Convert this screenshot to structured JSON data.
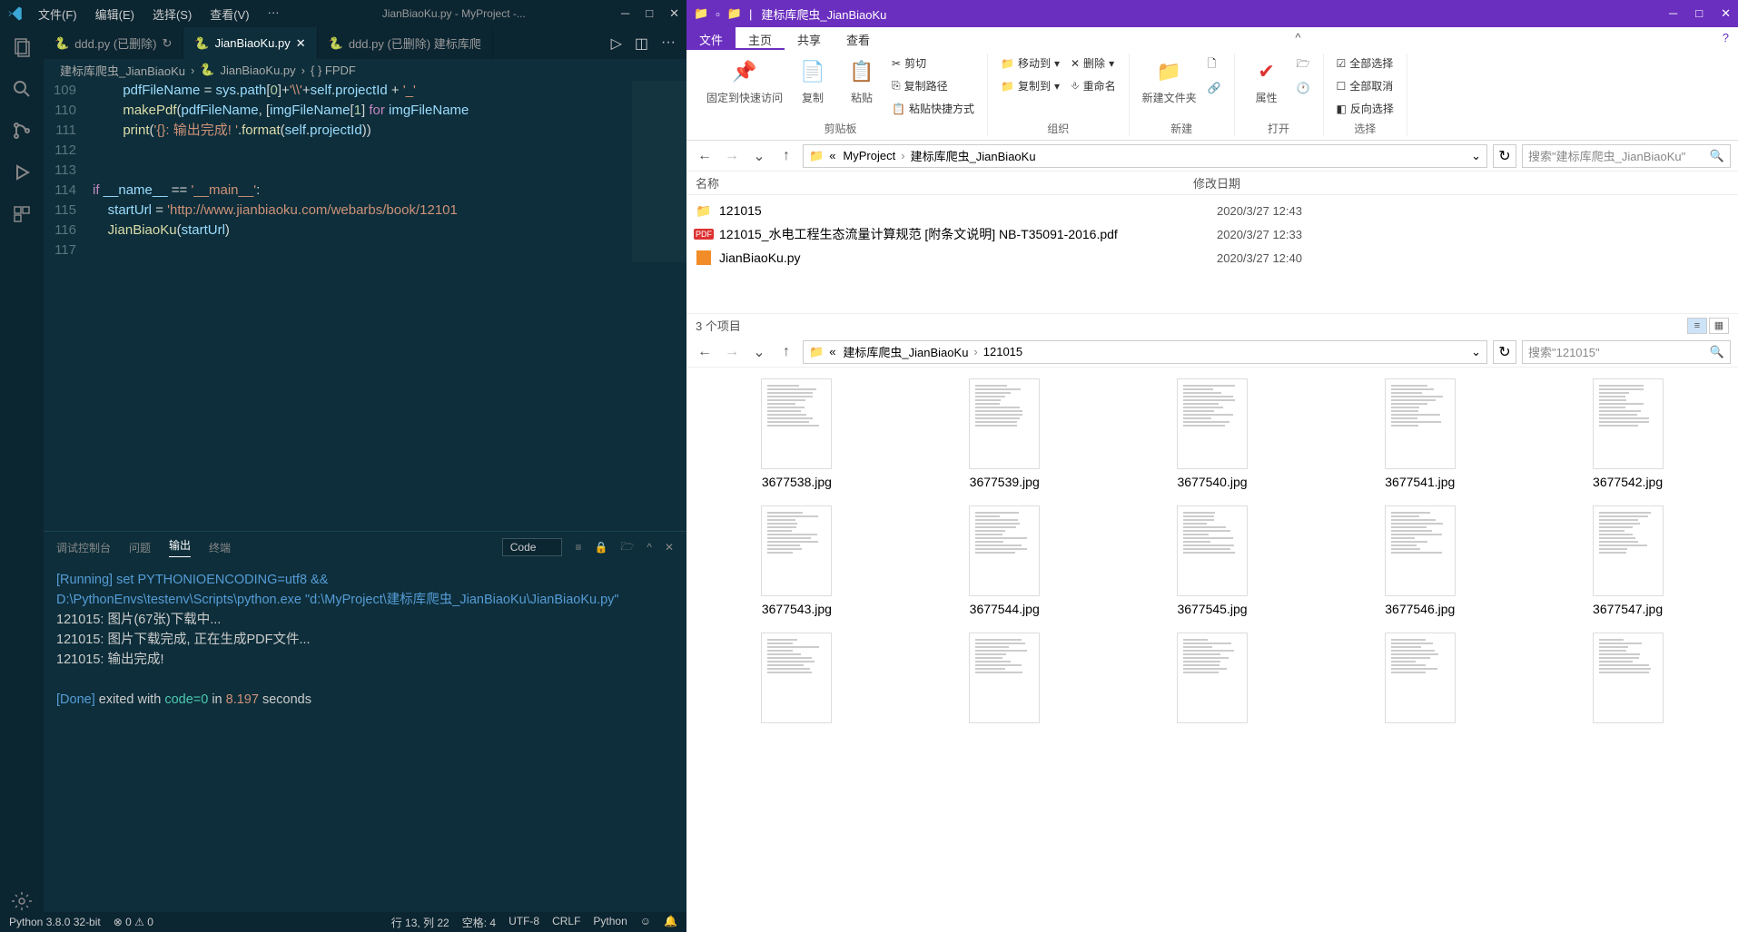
{
  "vscode": {
    "menu": [
      "文件(F)",
      "编辑(E)",
      "选择(S)",
      "查看(V)",
      "···"
    ],
    "title": "JianBiaoKu.py - MyProject -...",
    "tabs": [
      {
        "label": "ddd.py (已删除)",
        "active": false
      },
      {
        "label": "JianBiaoKu.py",
        "active": true
      },
      {
        "label": "ddd.py (已删除) 建标库爬",
        "active": false
      }
    ],
    "breadcrumb": [
      "建标库爬虫_JianBiaoKu",
      "JianBiaoKu.py",
      "{ } FPDF"
    ],
    "lines": {
      "109": "            pdfFileName = sys.path[0]+'\\\\'+self.projectId + '_'",
      "110": "            makePdf(pdfFileName, [imgFileName[1] for imgFileName",
      "111": "            print('{}: 输出完成! '.format(self.projectId))",
      "112": "",
      "113": "",
      "114": "    if __name__ == '__main__':",
      "115": "        startUrl = 'http://www.jianbiaoku.com/webarbs/book/12101",
      "116": "        JianBiaoKu(startUrl)",
      "117": ""
    },
    "panel": {
      "tabs": [
        "调试控制台",
        "问题",
        "输出",
        "终端"
      ],
      "active": "输出",
      "select": "Code",
      "output": {
        "l1a": "[Running]",
        "l1b": " set PYTHONIOENCODING=utf8 && ",
        "l2": "D:\\PythonEnvs\\testenv\\Scripts\\python.exe \"d:\\MyProject\\建标库爬虫_JianBiaoKu\\JianBiaoKu.py\"",
        "l3": "121015: 图片(67张)下载中...",
        "l4": "121015: 图片下载完成, 正在生成PDF文件...",
        "l5": "121015: 输出完成!",
        "l6a": "[Done]",
        "l6b": " exited with ",
        "l6c": "code=0",
        "l6d": " in ",
        "l6e": "8.197",
        "l6f": " seconds"
      }
    },
    "status": {
      "python": "Python 3.8.0 32-bit",
      "errors": "⊗ 0 ⚠ 0",
      "ln": "行 13, 列 22",
      "spaces": "空格: 4",
      "enc": "UTF-8",
      "eol": "CRLF",
      "lang": "Python"
    }
  },
  "explorer": {
    "title": "建标库爬虫_JianBiaoKu",
    "ribbon_tabs": {
      "file": "文件",
      "items": [
        "主页",
        "共享",
        "查看"
      ],
      "active": "主页"
    },
    "ribbon": {
      "pin": "固定到快速访问",
      "copy": "复制",
      "paste": "粘贴",
      "cut": "剪切",
      "copypath": "复制路径",
      "pasteshort": "粘贴快捷方式",
      "clipboard": "剪贴板",
      "moveto": "移动到",
      "copyto": "复制到",
      "delete": "删除",
      "rename": "重命名",
      "organize": "组织",
      "newfolder": "新建文件夹",
      "new": "新建",
      "props": "属性",
      "open": "打开",
      "selall": "全部选择",
      "selnone": "全部取消",
      "selinv": "反向选择",
      "select": "选择"
    },
    "top": {
      "path": [
        "«",
        "MyProject",
        "建标库爬虫_JianBiaoKu"
      ],
      "search": "搜索\"建标库爬虫_JianBiaoKu\"",
      "cols": {
        "name": "名称",
        "date": "修改日期"
      },
      "files": [
        {
          "icon": "folder",
          "name": "121015",
          "date": "2020/3/27 12:43"
        },
        {
          "icon": "pdf",
          "name": "121015_水电工程生态流量计算规范 [附条文说明] NB-T35091-2016.pdf",
          "date": "2020/3/27 12:33"
        },
        {
          "icon": "py",
          "name": "JianBiaoKu.py",
          "date": "2020/3/27 12:40"
        }
      ],
      "status": "3 个项目"
    },
    "bottom": {
      "path": [
        "«",
        "建标库爬虫_JianBiaoKu",
        "121015"
      ],
      "search": "搜索\"121015\"",
      "thumbs": [
        "3677538.jpg",
        "3677539.jpg",
        "3677540.jpg",
        "3677541.jpg",
        "3677542.jpg",
        "3677543.jpg",
        "3677544.jpg",
        "3677545.jpg",
        "3677546.jpg",
        "3677547.jpg"
      ]
    }
  }
}
